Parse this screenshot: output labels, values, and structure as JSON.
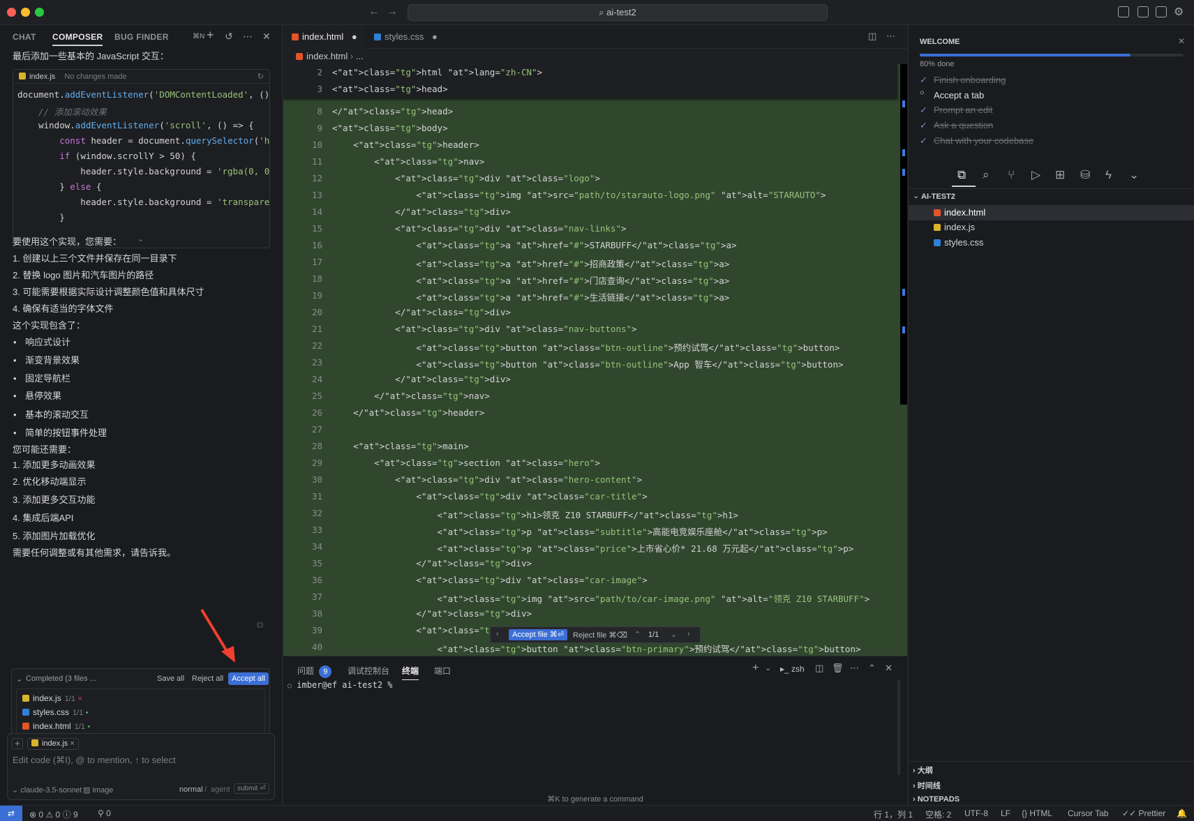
{
  "window": {
    "title": "ai-test2"
  },
  "composer": {
    "tabs": [
      "CHAT",
      "COMPOSER",
      "BUG FINDER"
    ],
    "shortcut": "⌘N",
    "intro": "最后添加一些基本的 JavaScript 交互：",
    "codeblock": {
      "file": "index.js",
      "status": "No changes made",
      "lines": [
        "document.addEventListener('DOMContentLoaded', () ",
        "    // 添加滚动效果",
        "    window.addEventListener('scroll', () => {",
        "        const header = document.querySelector('he",
        "        if (window.scrollY > 50) {",
        "            header.style.background = 'rgba(0, 0,",
        "        } else {",
        "            header.style.background = 'transparen",
        "        }"
      ]
    },
    "messages": [
      {
        "text": "要使用这个实现，您需要：",
        "bullet": false
      },
      {
        "text": "1. 创建以上三个文件并保存在同一目录下",
        "bullet": false
      },
      {
        "text": "2. 替换 logo 图片和汽车图片的路径",
        "bullet": false
      },
      {
        "text": "3. 可能需要根据实际设计调整颜色值和具体尺寸",
        "bullet": false
      },
      {
        "text": "4. 确保有适当的字体文件",
        "bullet": false
      },
      {
        "text": "这个实现包含了：",
        "bullet": false
      },
      {
        "text": "响应式设计",
        "bullet": true
      },
      {
        "text": "渐变背景效果",
        "bullet": true
      },
      {
        "text": "固定导航栏",
        "bullet": true
      },
      {
        "text": "悬停效果",
        "bullet": true
      },
      {
        "text": "基本的滚动交互",
        "bullet": true
      },
      {
        "text": "简单的按钮事件处理",
        "bullet": true
      },
      {
        "text": "您可能还需要：",
        "bullet": false
      },
      {
        "text": "1. 添加更多动画效果",
        "bullet": false
      },
      {
        "text": "2. 优化移动端显示",
        "bullet": false
      },
      {
        "text": "3. 添加更多交互功能",
        "bullet": false
      },
      {
        "text": "4. 集成后端API",
        "bullet": false
      },
      {
        "text": "5. 添加图片加载优化",
        "bullet": false
      },
      {
        "text": "需要任何调整或有其他需求，请告诉我。",
        "bullet": false
      }
    ],
    "completed": {
      "label": "Completed (3 files ...",
      "save_all": "Save all",
      "reject_all": "Reject all",
      "accept_all": "Accept all",
      "files": [
        {
          "name": "index.js",
          "meta": "1/1",
          "mark": "×",
          "type": "js"
        },
        {
          "name": "styles.css",
          "meta": "1/1",
          "mark": "•",
          "type": "css"
        },
        {
          "name": "index.html",
          "meta": "1/1",
          "mark": "•",
          "type": "html"
        }
      ]
    },
    "input": {
      "chip": "index.js",
      "placeholder": "Edit code (⌘I), @ to mention, ↑ to select",
      "model": "claude-3.5-sonnet",
      "image": "image",
      "mode_normal": "normal",
      "mode_agent": "agent",
      "submit": "submit ⏎"
    }
  },
  "editor": {
    "tabs": [
      {
        "name": "index.html",
        "type": "html"
      },
      {
        "name": "styles.css",
        "type": "css"
      }
    ],
    "breadcrumb": [
      "index.html",
      "..."
    ],
    "sticky_lines": [
      {
        "n": "2",
        "code": "<html lang=\"zh-CN\">"
      },
      {
        "n": "3",
        "code": "<head>"
      }
    ],
    "lines": [
      {
        "n": "8",
        "code": "</head>"
      },
      {
        "n": "9",
        "code": "<body>"
      },
      {
        "n": "10",
        "code": "    <header>"
      },
      {
        "n": "11",
        "code": "        <nav>"
      },
      {
        "n": "12",
        "code": "            <div class=\"logo\">"
      },
      {
        "n": "13",
        "code": "                <img src=\"path/to/starauto-logo.png\" alt=\"STARAUTO\">"
      },
      {
        "n": "14",
        "code": "            </div>"
      },
      {
        "n": "15",
        "code": "            <div class=\"nav-links\">"
      },
      {
        "n": "16",
        "code": "                <a href=\"#\">STARBUFF</a>"
      },
      {
        "n": "17",
        "code": "                <a href=\"#\">招商政策</a>"
      },
      {
        "n": "18",
        "code": "                <a href=\"#\">门店查询</a>"
      },
      {
        "n": "19",
        "code": "                <a href=\"#\">生活链接</a>"
      },
      {
        "n": "20",
        "code": "            </div>"
      },
      {
        "n": "21",
        "code": "            <div class=\"nav-buttons\">"
      },
      {
        "n": "22",
        "code": "                <button class=\"btn-outline\">预约试驾</button>"
      },
      {
        "n": "23",
        "code": "                <button class=\"btn-outline\">App 智车</button>"
      },
      {
        "n": "24",
        "code": "            </div>"
      },
      {
        "n": "25",
        "code": "        </nav>"
      },
      {
        "n": "26",
        "code": "    </header>"
      },
      {
        "n": "27",
        "code": ""
      },
      {
        "n": "28",
        "code": "    <main>"
      },
      {
        "n": "29",
        "code": "        <section class=\"hero\">"
      },
      {
        "n": "30",
        "code": "            <div class=\"hero-content\">"
      },
      {
        "n": "31",
        "code": "                <div class=\"car-title\">"
      },
      {
        "n": "32",
        "code": "                    <h1>领克 Z10 STARBUFF</h1>"
      },
      {
        "n": "33",
        "code": "                    <p class=\"subtitle\">高能电竞娱乐座舱</p>"
      },
      {
        "n": "34",
        "code": "                    <p class=\"price\">上市省心价* 21.68 万元起</p>"
      },
      {
        "n": "35",
        "code": "                </div>"
      },
      {
        "n": "36",
        "code": "                <div class=\"car-image\">"
      },
      {
        "n": "37",
        "code": "                    <img src=\"path/to/car-image.png\" alt=\"领克 Z10 STARBUFF\">"
      },
      {
        "n": "38",
        "code": "                </div>"
      },
      {
        "n": "39",
        "code": "                <div class=\"cta"
      },
      {
        "n": "40",
        "code": "                    <button class=\"btn-primary\">预约试驾</button>"
      }
    ],
    "inline_bar": {
      "accept": "Accept file ⌘⏎",
      "reject": "Reject file ⌘⌫",
      "count": "1/1"
    }
  },
  "terminal": {
    "tabs": [
      "问题",
      "调试控制台",
      "终端",
      "端口"
    ],
    "problems_count": "9",
    "shell": "zsh",
    "prompt": "imber@ef ai-test2 %",
    "hint": "⌘K to generate a command"
  },
  "sidebar": {
    "welcome_title": "WELCOME",
    "progress_label": "80% done",
    "progress_fraction": 0.8,
    "checklist": [
      {
        "label": "Finish onboarding",
        "done": true
      },
      {
        "label": "Accept a tab",
        "done": false
      },
      {
        "label": "Prompt an edit",
        "done": true
      },
      {
        "label": "Ask a question",
        "done": true
      },
      {
        "label": "Chat with your codebase",
        "done": true
      }
    ],
    "project": "AI-TEST2",
    "files": [
      {
        "name": "index.html",
        "type": "html"
      },
      {
        "name": "index.js",
        "type": "js"
      },
      {
        "name": "styles.css",
        "type": "css"
      }
    ],
    "bottom_sections": [
      "大纲",
      "时间线",
      "NOTEPADS"
    ]
  },
  "statusbar": {
    "errors": "0",
    "warnings": "0",
    "info": "9",
    "ports": "0",
    "position": "行 1，列 1",
    "spaces": "空格: 2",
    "encoding": "UTF-8",
    "eol": "LF",
    "language": "HTML",
    "cursor_tab": "Cursor Tab",
    "prettier": "Prettier"
  }
}
